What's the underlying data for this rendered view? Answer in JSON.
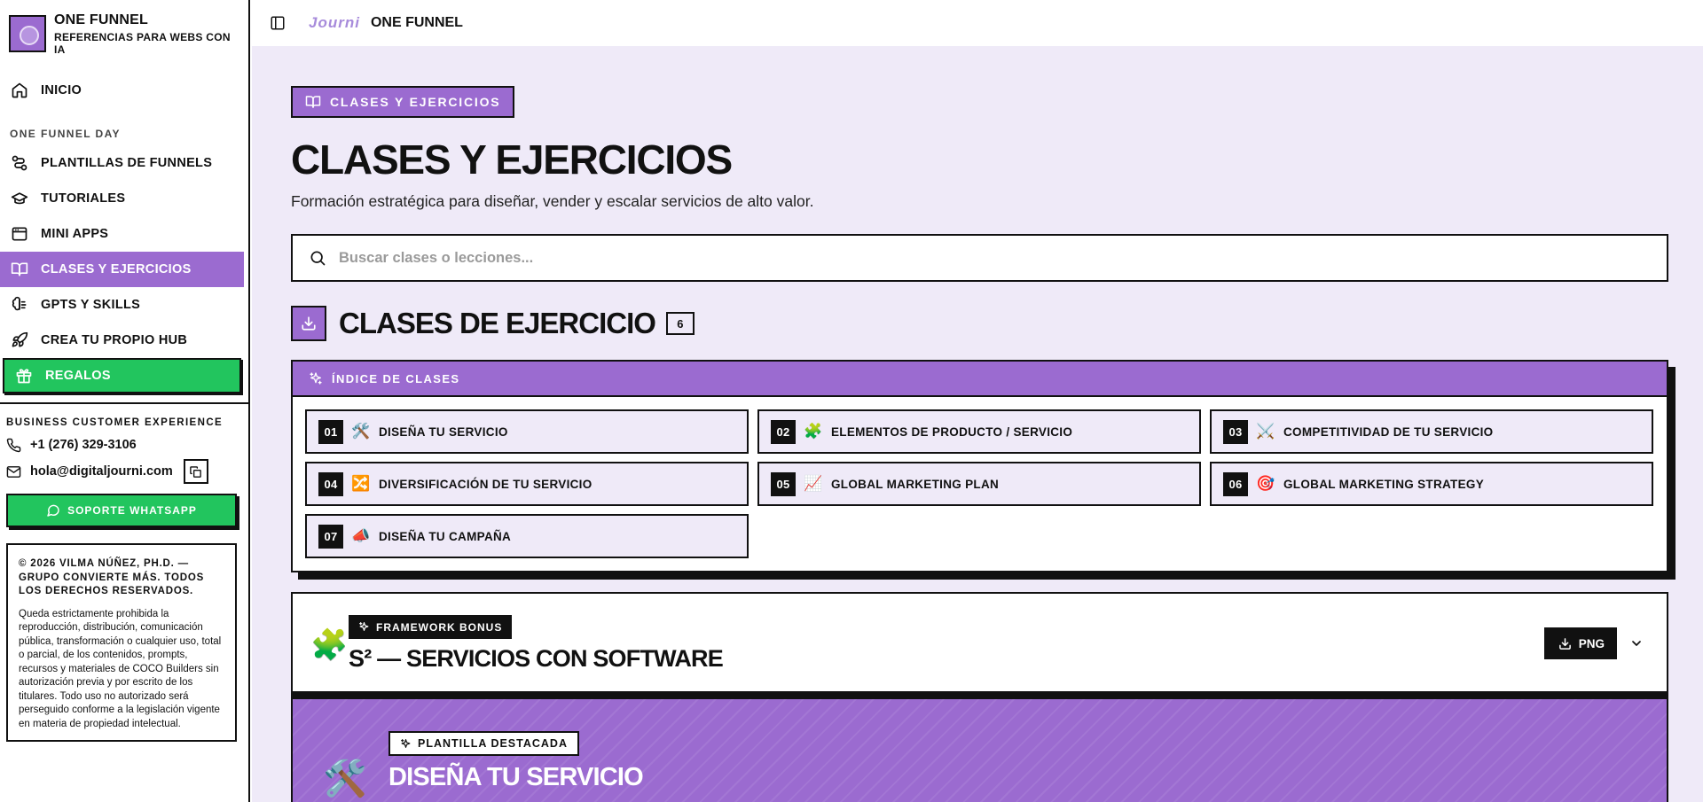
{
  "brand": {
    "title": "ONE FUNNEL",
    "subtitle": "REFERENCIAS PARA WEBS CON IA"
  },
  "nav": {
    "home": "INICIO",
    "section_label": "ONE FUNNEL DAY",
    "items": [
      {
        "label": "PLANTILLAS DE FUNNELS",
        "icon": "funnel-route-icon"
      },
      {
        "label": "TUTORIALES",
        "icon": "graduation-cap-icon"
      },
      {
        "label": "MINI APPS",
        "icon": "app-window-icon"
      },
      {
        "label": "CLASES Y EJERCICIOS",
        "icon": "book-open-icon",
        "active": true
      },
      {
        "label": "GPTS Y SKILLS",
        "icon": "brain-icon"
      },
      {
        "label": "CREA TU PROPIO HUB",
        "icon": "rocket-icon"
      },
      {
        "label": "REGALOS",
        "icon": "gift-icon"
      }
    ]
  },
  "contact": {
    "title": "BUSINESS CUSTOMER EXPERIENCE",
    "phone": "+1 (276) 329-3106",
    "email": "hola@digitaljourni.com",
    "whatsapp_label": "SOPORTE WHATSAPP"
  },
  "legal": {
    "title": "© 2026 VILMA NÚÑEZ, PH.D. — GRUPO CONVIERTE MÁS. TODOS LOS DERECHOS RESERVADOS.",
    "text": "Queda estrictamente prohibida la reproducción, distribución, comunicación pública, transformación o cualquier uso, total o parcial, de los contenidos, prompts, recursos y materiales de COCO Builders sin autorización previa y por escrito de los titulares. Todo uso no autorizado será perseguido conforme a la legislación vigente en materia de propiedad intelectual."
  },
  "topbar": {
    "logo": "Journi",
    "title": "ONE FUNNEL"
  },
  "page": {
    "chip": "CLASES Y EJERCICIOS",
    "title": "CLASES Y EJERCICIOS",
    "subtitle": "Formación estratégica para diseñar, vender y escalar servicios de alto valor.",
    "search_placeholder": "Buscar clases o lecciones..."
  },
  "section": {
    "title": "CLASES DE EJERCICIO",
    "count": "6"
  },
  "index": {
    "title": "ÍNDICE DE CLASES",
    "items": [
      {
        "num": "01",
        "emoji": "🛠️",
        "label": "DISEÑA TU SERVICIO"
      },
      {
        "num": "02",
        "emoji": "🧩",
        "label": "ELEMENTOS DE PRODUCTO / SERVICIO"
      },
      {
        "num": "03",
        "emoji": "⚔️",
        "label": "COMPETITIVIDAD DE TU SERVICIO"
      },
      {
        "num": "04",
        "emoji": "🔀",
        "label": "DIVERSIFICACIÓN DE TU SERVICIO"
      },
      {
        "num": "05",
        "emoji": "📈",
        "label": "GLOBAL MARKETING PLAN"
      },
      {
        "num": "06",
        "emoji": "🎯",
        "label": "GLOBAL MARKETING STRATEGY"
      },
      {
        "num": "07",
        "emoji": "📣",
        "label": "DISEÑA TU CAMPAÑA"
      }
    ]
  },
  "framework": {
    "emoji": "🧩",
    "tag": "FRAMEWORK BONUS",
    "title": "S² — SERVICIOS CON SOFTWARE",
    "png_label": "PNG"
  },
  "featured": {
    "emoji": "🛠️",
    "tag": "PLANTILLA DESTACADA",
    "title": "DISEÑA TU SERVICIO"
  },
  "colors": {
    "accent": "#9b6bd0",
    "green": "#22c55e",
    "background": "#efeaf8",
    "ink": "#111111"
  }
}
